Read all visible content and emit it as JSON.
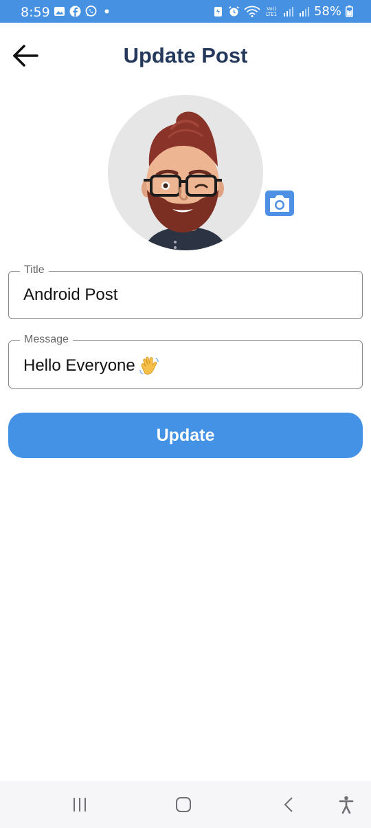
{
  "status_bar": {
    "time": "8:59",
    "battery": "58%",
    "background_color": "#4791e3",
    "left_icons": [
      "gallery-icon",
      "facebook-icon",
      "whatsapp-icon",
      "dot-icon"
    ],
    "right_icons": [
      "data-saver-icon",
      "alarm-icon",
      "wifi-icon",
      "volte-icon",
      "signal-icon",
      "signal-icon",
      "battery-icon"
    ]
  },
  "header": {
    "title": "Update Post",
    "title_color": "#24385b",
    "back_icon": "arrow-left-icon"
  },
  "avatar": {
    "icon": "avatar-memoji",
    "camera_icon": "camera-icon",
    "camera_color": "#4e91e4"
  },
  "form": {
    "title_label": "Title",
    "title_value": "Android Post",
    "message_label": "Message",
    "message_value": "Hello Everyone",
    "message_emoji": "waving-hand-icon"
  },
  "update_button": {
    "label": "Update",
    "color": "#4492e6"
  },
  "nav_bar": {
    "icons": [
      "recents-icon",
      "home-icon",
      "back-icon",
      "accessibility-icon"
    ]
  }
}
